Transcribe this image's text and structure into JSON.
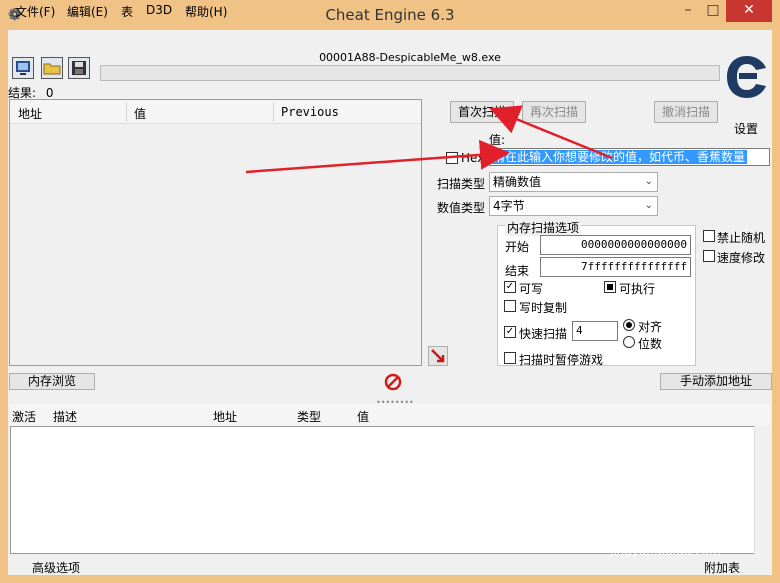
{
  "window": {
    "title": "Cheat Engine 6.3",
    "minimize": "–",
    "maximize": "□",
    "close": "✕"
  },
  "menu": [
    "文件(F)",
    "编辑(E)",
    "表",
    "D3D",
    "帮助(H)"
  ],
  "toolbar": {
    "process_name": "00001A88-DespicableMe_w8.exe",
    "icons": [
      "open-process-icon",
      "open-folder-icon",
      "save-icon"
    ]
  },
  "settings_label": "设置",
  "results": {
    "label": "结果:",
    "count": "0"
  },
  "found_list": {
    "columns": [
      "地址",
      "值",
      "Previous"
    ]
  },
  "scan": {
    "first_scan": "首次扫描",
    "next_scan": "再次扫描",
    "undo_scan": "撤消扫描",
    "value_label": "值:",
    "hex_label": "Hex",
    "value_input": "请在此输入你想要修改的值，如代币、香蕉数量",
    "scan_type_label": "扫描类型",
    "scan_type_value": "精确数值",
    "value_type_label": "数值类型",
    "value_type_value": "4字节"
  },
  "memory_options": {
    "title": "内存扫描选项",
    "start_label": "开始",
    "start_value": "0000000000000000",
    "end_label": "结束",
    "end_value": "7fffffffffffffff",
    "writable": "可写",
    "executable": "可执行",
    "copy_on_write": "写时复制",
    "fast_scan": "快速扫描",
    "fast_scan_value": "4",
    "align": "对齐",
    "last_digits": "位数",
    "pause_game": "扫描时暂停游戏"
  },
  "side_options": {
    "disable_random": "禁止随机",
    "speed_hack": "速度修改"
  },
  "memory_view_button": "内存浏览",
  "add_address_button": "手动添加地址",
  "cheat_table": {
    "columns": [
      "激活",
      "描述",
      "地址",
      "类型",
      "值"
    ]
  },
  "status": {
    "advanced": "高级选项",
    "table_extras": "附加表"
  },
  "watermark": {
    "main": "Bai du 经验",
    "sub": "jingyan.baidu.com"
  },
  "colors": {
    "title_bar": "#f0c286",
    "close": "#c7372f",
    "selection": "#3399ff",
    "arrow": "#e0202a"
  }
}
